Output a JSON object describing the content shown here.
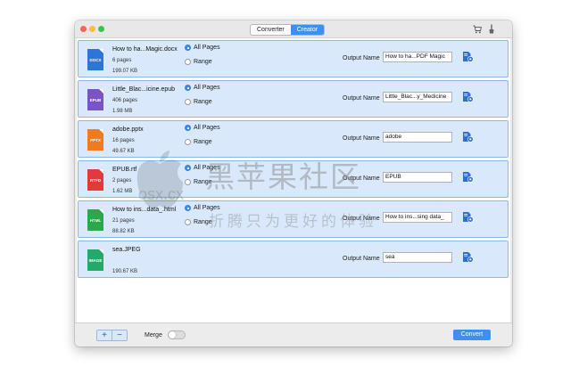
{
  "toolbar": {
    "tabs": [
      {
        "label": "Converter",
        "active": false
      },
      {
        "label": "Creator",
        "active": true
      }
    ],
    "cart_icon": "cart-icon",
    "brush_icon": "brush-icon"
  },
  "files": [
    {
      "name": "How to ha...Magic.docx",
      "pages": "6 pages",
      "size": "199.07 KB",
      "icon_label": "DOCX",
      "color": "#2b77d8",
      "radio": [
        "All Pages",
        "Range"
      ],
      "output_label": "Output Name",
      "output_value": "How to ha...PDF Magic"
    },
    {
      "name": "Little_Blac...icine.epub",
      "pages": "406 pages",
      "size": "1.98 MB",
      "icon_label": "EPUB",
      "color": "#7b53c9",
      "radio": [
        "All Pages",
        "Range"
      ],
      "output_label": "Output Name",
      "output_value": "Little_Blac...y_Medicine"
    },
    {
      "name": "adobe.pptx",
      "pages": "16 pages",
      "size": "49.67 KB",
      "icon_label": "PPTX",
      "color": "#f07a1f",
      "radio": [
        "All Pages",
        "Range"
      ],
      "output_label": "Output Name",
      "output_value": "adobe"
    },
    {
      "name": "EPUB.rtf",
      "pages": "2 pages",
      "size": "1.62 MB",
      "icon_label": "RTFD",
      "color": "#e23a3a",
      "radio": [
        "All Pages",
        "Range"
      ],
      "output_label": "Output Name",
      "output_value": "EPUB"
    },
    {
      "name": "How to ins...data_.html",
      "pages": "21 pages",
      "size": "88.82 KB",
      "icon_label": "HTML",
      "color": "#2aa84a",
      "radio": [
        "All Pages",
        "Range"
      ],
      "output_label": "Output Name",
      "output_value": "How to ins...sing data_"
    },
    {
      "name": "sea.JPEG",
      "pages": "",
      "size": "190.67 KB",
      "icon_label": "IMAGE",
      "color": "#25a868",
      "radio": [],
      "output_label": "Output Name",
      "output_value": "sea"
    }
  ],
  "bottom": {
    "add_label": "+",
    "remove_label": "−",
    "merge_label": "Merge",
    "merge_on": false,
    "convert_label": "Convert"
  },
  "watermark": {
    "name": "黑苹果社区",
    "domain": "osx.cx",
    "slogan": "折腾只为更好的体验"
  },
  "colors": {
    "accent": "#3d8ff3",
    "row_bg": "#d9e9fb",
    "row_border": "#8fb8e6"
  }
}
